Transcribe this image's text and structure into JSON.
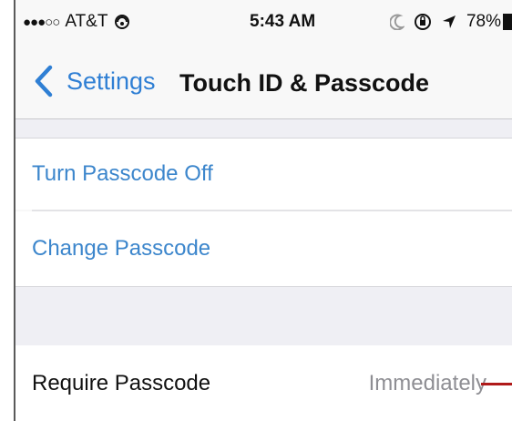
{
  "status_bar": {
    "signal": "●●●○○",
    "carrier": "AT&T",
    "wifi_icon": "wifi-icon",
    "time": "5:43 AM",
    "moon_icon": "moon-icon",
    "rotation_lock_icon": "rotation-lock-icon",
    "location_icon": "location-arrow-icon",
    "battery": "78%"
  },
  "nav": {
    "back_label": "Settings",
    "title": "Touch ID & Passcode"
  },
  "sections": [
    {
      "cells": [
        {
          "label": "Turn Passcode Off"
        },
        {
          "label": "Change Passcode"
        }
      ]
    },
    {
      "cells": [
        {
          "label": "Require Passcode",
          "value": "Immediately"
        }
      ]
    }
  ],
  "colors": {
    "link": "#3c86cc",
    "nav_back": "#2f7fd4",
    "value": "#8e8e93",
    "callout": "#b01a1a",
    "group_background": "#efeff4"
  }
}
